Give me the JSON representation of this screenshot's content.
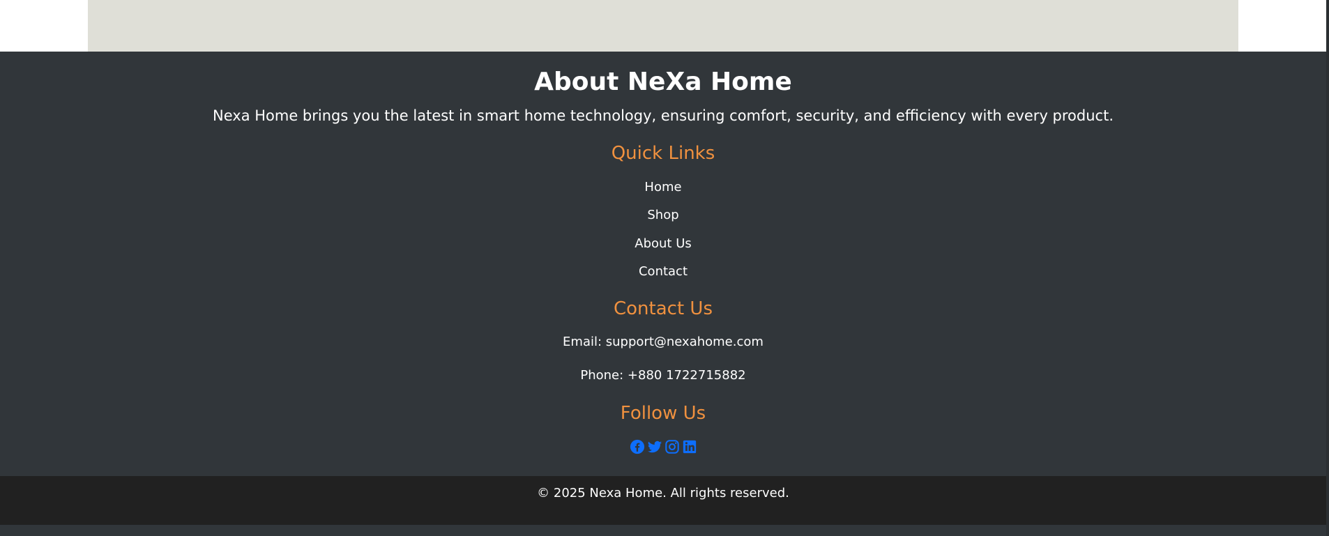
{
  "footer": {
    "about": {
      "title": "About NeXa Home",
      "text": "Nexa Home brings you the latest in smart home technology, ensuring comfort, security, and efficiency with every product."
    },
    "quick_links": {
      "heading": "Quick Links",
      "items": [
        {
          "label": "Home"
        },
        {
          "label": "Shop"
        },
        {
          "label": "About Us"
        },
        {
          "label": "Contact"
        }
      ]
    },
    "contact": {
      "heading": "Contact Us",
      "email": "Email: support@nexahome.com",
      "phone": "Phone: +880 1722715882"
    },
    "follow": {
      "heading": "Follow Us",
      "icons": [
        "facebook-icon",
        "twitter-icon",
        "instagram-icon",
        "linkedin-icon"
      ],
      "icon_color": "#0d6efd"
    },
    "copyright": "© 2025 Nexa Home. All rights reserved."
  },
  "colors": {
    "footer_bg": "#31363a",
    "bottom_bar_bg": "#212121",
    "heading_accent": "#f0913f",
    "top_panel": "#dfdfd7"
  }
}
